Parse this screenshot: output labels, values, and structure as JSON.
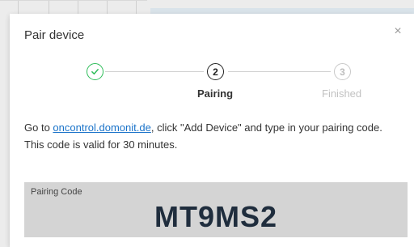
{
  "dialog": {
    "title": "Pair device",
    "close_glyph": "×"
  },
  "stepper": {
    "steps": [
      {
        "number": "",
        "label": "",
        "status": "completed",
        "icon": "check-icon"
      },
      {
        "number": "2",
        "label": "Pairing",
        "status": "active"
      },
      {
        "number": "3",
        "label": "Finished",
        "status": "pending"
      }
    ]
  },
  "instructions": {
    "prefix": "Go to ",
    "link_text": "oncontrol.domonit.de",
    "suffix": ", click \"Add Device\" and type in your pairing code.",
    "validity": "This code is valid for 30 minutes."
  },
  "pairing": {
    "label": "Pairing Code",
    "code": "MT9MS2"
  },
  "colors": {
    "success": "#2ebd59",
    "link": "#1a73c9",
    "code_text": "#1f2d3d",
    "code_bg": "#d4d4d4"
  }
}
